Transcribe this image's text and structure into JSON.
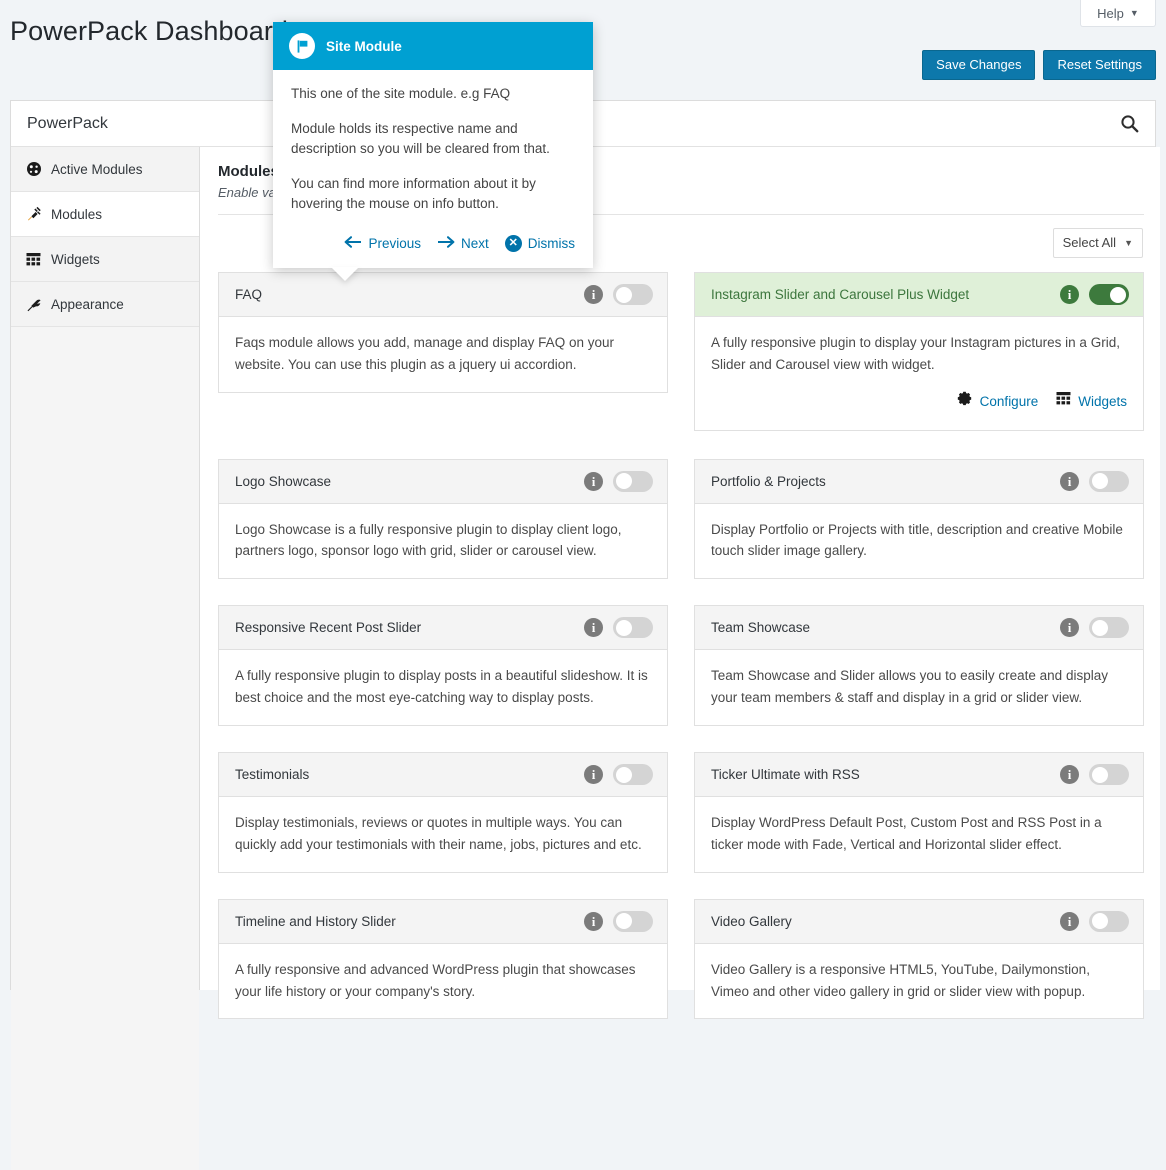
{
  "header": {
    "page_title": "PowerPack Dashboard",
    "help_label": "Help",
    "help_caret": "▼",
    "save_label": "Save Changes",
    "reset_label": "Reset Settings"
  },
  "panel": {
    "brand": "PowerPack",
    "search_icon": "search-icon"
  },
  "sidebar": {
    "items": [
      {
        "label": "Active Modules",
        "icon": "dashboard-icon",
        "active": false
      },
      {
        "label": "Modules",
        "icon": "plug-icon",
        "active": true
      },
      {
        "label": "Widgets",
        "icon": "widgets-grid-icon",
        "active": false
      },
      {
        "label": "Appearance",
        "icon": "paintbrush-icon",
        "active": false
      }
    ]
  },
  "content": {
    "title": "Modules",
    "subtitle": "Enable various modules",
    "select_all_label": "Select All",
    "select_all_caret": "▼"
  },
  "pointer": {
    "title": "Site Module",
    "icon": "flag-icon",
    "paragraphs": [
      "This one of the site module. e.g FAQ",
      "Module holds its respective name and description so you will be cleared from that.",
      "You can find more information about it by hovering the mouse on info button."
    ],
    "previous_label": "Previous",
    "previous_icon": "arrow-left-icon",
    "next_label": "Next",
    "next_icon": "arrow-right-icon",
    "dismiss_label": "Dismiss",
    "dismiss_icon": "close-circle-icon",
    "accent_color": "#00a0d2"
  },
  "modules": [
    {
      "title": "FAQ",
      "description": "Faqs module allows you add, manage and display FAQ on your website. You can use this plugin as a jquery ui accordion.",
      "enabled": false,
      "links": []
    },
    {
      "title": "Instagram Slider and Carousel Plus Widget",
      "description": "A fully responsive plugin to display your Instagram pictures in a Grid, Slider and Carousel view with widget.",
      "enabled": true,
      "links": [
        {
          "label": "Configure",
          "icon": "gear-icon"
        },
        {
          "label": "Widgets",
          "icon": "widgets-grid-icon"
        }
      ]
    },
    {
      "title": "Logo Showcase",
      "description": "Logo Showcase is a fully responsive plugin to display client logo, partners logo, sponsor logo with grid, slider or carousel view.",
      "enabled": false,
      "links": []
    },
    {
      "title": "Portfolio & Projects",
      "description": "Display Portfolio or Projects with title, description and creative Mobile touch slider image gallery.",
      "enabled": false,
      "links": []
    },
    {
      "title": "Responsive Recent Post Slider",
      "description": "A fully responsive plugin to display posts in a beautiful slideshow. It is best choice and the most eye-catching way to display posts.",
      "enabled": false,
      "links": []
    },
    {
      "title": "Team Showcase",
      "description": "Team Showcase and Slider allows you to easily create and display your team members & staff and display in a grid or slider view.",
      "enabled": false,
      "links": []
    },
    {
      "title": "Testimonials",
      "description": "Display testimonials, reviews or quotes in multiple ways. You can quickly add your testimonials with their name, jobs, pictures and etc.",
      "enabled": false,
      "links": []
    },
    {
      "title": "Ticker Ultimate with RSS",
      "description": "Display WordPress Default Post, Custom Post and RSS Post in a ticker mode with Fade, Vertical and Horizontal slider effect.",
      "enabled": false,
      "links": []
    },
    {
      "title": "Timeline and History Slider",
      "description": "A fully responsive and advanced WordPress plugin that showcases your life history or your company's story.",
      "enabled": false,
      "links": []
    },
    {
      "title": "Video Gallery",
      "description": "Video Gallery is a responsive HTML5, YouTube, Dailymonstion, Vimeo and other video gallery in grid or slider view with popup.",
      "enabled": false,
      "links": []
    }
  ],
  "colors": {
    "accent_blue": "#0d78ab",
    "link_blue": "#0073aa",
    "pointer_blue": "#00a0d2",
    "active_green_bg": "#dff0d8",
    "active_green": "#3d7a3d"
  }
}
